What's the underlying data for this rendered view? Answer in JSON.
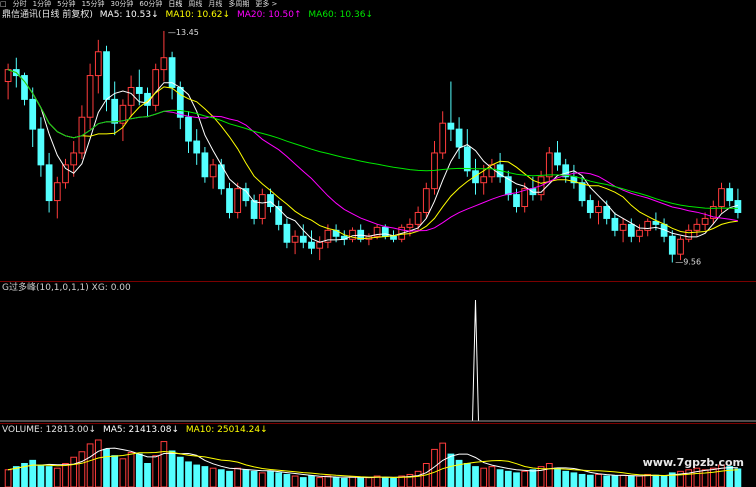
{
  "toolbar": {
    "items": [
      "□",
      "分时",
      "1分钟",
      "5分钟",
      "15分钟",
      "30分钟",
      "60分钟",
      "日线",
      "周线",
      "月线",
      "多周期",
      "更多 >"
    ],
    "active_index": 7
  },
  "main_legend": {
    "title": "鼎信通讯(日线 前复权)",
    "ma5_label": "MA5: 10.53↓",
    "ma10_label": "MA10: 10.62↓",
    "ma20_label": "MA20: 10.50↑",
    "ma60_label": "MA60: 10.36↓"
  },
  "indicator_legend": {
    "text": "G过多峰(10,1,0,1,1)  XG: 0.00"
  },
  "volume_legend": {
    "volume_label": "VOLUME: 12813.00↓",
    "ma5_label": "MA5: 21413.08↓",
    "ma10_label": "MA10: 25014.24↓"
  },
  "watermark": "www.7gpzb.com",
  "colors": {
    "up": "#ff3c3c",
    "down": "#54ffff",
    "ma5": "#ffffff",
    "ma10": "#ffff00",
    "ma20": "#ff00ff",
    "ma60": "#00e600",
    "signal": "#ffffff",
    "grid": "#7a0000"
  },
  "chart_data": {
    "type": "candlestick",
    "price_high_label": "13.45",
    "price_low_label": "9.56",
    "ohlc": [
      [
        12.6,
        12.9,
        12.3,
        12.8
      ],
      [
        12.8,
        13.0,
        12.5,
        12.7
      ],
      [
        12.7,
        12.75,
        12.2,
        12.3
      ],
      [
        12.3,
        12.5,
        11.5,
        11.8
      ],
      [
        11.8,
        12.0,
        11.0,
        11.2
      ],
      [
        11.2,
        11.4,
        10.4,
        10.6
      ],
      [
        10.6,
        11.0,
        10.3,
        10.9
      ],
      [
        10.9,
        11.3,
        10.8,
        11.2
      ],
      [
        11.2,
        11.6,
        11.0,
        11.4
      ],
      [
        11.4,
        12.2,
        11.3,
        12.0
      ],
      [
        12.0,
        12.9,
        11.8,
        12.7
      ],
      [
        12.7,
        13.3,
        12.4,
        13.1
      ],
      [
        13.1,
        13.2,
        12.1,
        12.3
      ],
      [
        12.3,
        12.6,
        11.7,
        11.9
      ],
      [
        11.9,
        12.3,
        11.6,
        12.2
      ],
      [
        12.2,
        12.7,
        12.0,
        12.5
      ],
      [
        12.5,
        12.8,
        12.2,
        12.4
      ],
      [
        12.4,
        12.5,
        12.0,
        12.2
      ],
      [
        12.2,
        12.9,
        12.1,
        12.8
      ],
      [
        12.8,
        13.45,
        12.6,
        13.0
      ],
      [
        13.0,
        13.1,
        12.3,
        12.5
      ],
      [
        12.5,
        12.6,
        11.8,
        12.0
      ],
      [
        12.0,
        12.1,
        11.4,
        11.6
      ],
      [
        11.6,
        11.8,
        11.2,
        11.4
      ],
      [
        11.4,
        11.5,
        10.9,
        11.0
      ],
      [
        11.0,
        11.3,
        10.8,
        11.2
      ],
      [
        11.2,
        11.3,
        10.7,
        10.8
      ],
      [
        10.8,
        10.9,
        10.3,
        10.4
      ],
      [
        10.4,
        10.9,
        10.3,
        10.8
      ],
      [
        10.8,
        10.9,
        10.5,
        10.6
      ],
      [
        10.6,
        10.7,
        10.2,
        10.3
      ],
      [
        10.3,
        10.8,
        10.2,
        10.7
      ],
      [
        10.7,
        10.8,
        10.4,
        10.5
      ],
      [
        10.5,
        10.6,
        10.1,
        10.2
      ],
      [
        10.2,
        10.3,
        9.8,
        9.9
      ],
      [
        9.9,
        10.1,
        9.7,
        10.0
      ],
      [
        10.0,
        10.2,
        9.8,
        9.9
      ],
      [
        9.9,
        10.1,
        9.7,
        9.8
      ],
      [
        9.8,
        10.0,
        9.6,
        9.9
      ],
      [
        9.9,
        10.2,
        9.8,
        10.1
      ],
      [
        10.1,
        10.2,
        9.9,
        10.0
      ],
      [
        10.0,
        10.1,
        9.85,
        9.95
      ],
      [
        9.95,
        10.15,
        9.9,
        10.1
      ],
      [
        10.1,
        10.2,
        9.9,
        9.95
      ],
      [
        9.95,
        10.05,
        9.85,
        10.0
      ],
      [
        10.0,
        10.2,
        9.95,
        10.15
      ],
      [
        10.15,
        10.2,
        9.95,
        10.0
      ],
      [
        10.0,
        10.1,
        9.9,
        9.95
      ],
      [
        9.95,
        10.2,
        9.9,
        10.15
      ],
      [
        10.15,
        10.3,
        10.0,
        10.2
      ],
      [
        10.2,
        10.5,
        10.1,
        10.4
      ],
      [
        10.4,
        10.9,
        10.3,
        10.8
      ],
      [
        10.8,
        11.6,
        10.7,
        11.4
      ],
      [
        11.4,
        12.1,
        11.3,
        11.9
      ],
      [
        11.9,
        12.6,
        11.6,
        11.8
      ],
      [
        11.8,
        12.0,
        11.3,
        11.5
      ],
      [
        11.5,
        11.8,
        11.0,
        11.1
      ],
      [
        11.1,
        11.3,
        10.7,
        10.9
      ],
      [
        10.9,
        11.2,
        10.7,
        11.0
      ],
      [
        11.0,
        11.3,
        10.9,
        11.2
      ],
      [
        11.2,
        11.4,
        10.9,
        11.0
      ],
      [
        11.0,
        11.1,
        10.6,
        10.7
      ],
      [
        10.7,
        10.8,
        10.4,
        10.5
      ],
      [
        10.5,
        10.9,
        10.4,
        10.8
      ],
      [
        10.8,
        11.0,
        10.6,
        10.7
      ],
      [
        10.7,
        11.1,
        10.6,
        11.0
      ],
      [
        11.0,
        11.5,
        10.9,
        11.4
      ],
      [
        11.4,
        11.6,
        11.1,
        11.2
      ],
      [
        11.2,
        11.3,
        10.9,
        11.0
      ],
      [
        11.0,
        11.2,
        10.8,
        10.9
      ],
      [
        10.9,
        11.0,
        10.5,
        10.6
      ],
      [
        10.6,
        10.7,
        10.3,
        10.4
      ],
      [
        10.4,
        10.6,
        10.2,
        10.5
      ],
      [
        10.5,
        10.6,
        10.2,
        10.3
      ],
      [
        10.3,
        10.4,
        10.0,
        10.1
      ],
      [
        10.1,
        10.3,
        9.9,
        10.2
      ],
      [
        10.2,
        10.3,
        9.9,
        10.0
      ],
      [
        10.0,
        10.2,
        9.9,
        10.1
      ],
      [
        10.1,
        10.3,
        10.0,
        10.25
      ],
      [
        10.25,
        10.4,
        10.1,
        10.2
      ],
      [
        10.2,
        10.3,
        9.9,
        10.0
      ],
      [
        10.0,
        10.1,
        9.56,
        9.7
      ],
      [
        9.7,
        10.0,
        9.6,
        9.95
      ],
      [
        9.95,
        10.2,
        9.9,
        10.1
      ],
      [
        10.1,
        10.3,
        10.0,
        10.2
      ],
      [
        10.2,
        10.4,
        10.1,
        10.3
      ],
      [
        10.3,
        10.6,
        10.2,
        10.5
      ],
      [
        10.5,
        10.9,
        10.4,
        10.8
      ],
      [
        10.8,
        10.9,
        10.5,
        10.6
      ],
      [
        10.6,
        10.8,
        10.3,
        10.4
      ]
    ],
    "volume": [
      22,
      26,
      30,
      34,
      28,
      26,
      24,
      30,
      38,
      45,
      55,
      60,
      48,
      40,
      36,
      44,
      42,
      30,
      40,
      58,
      46,
      38,
      32,
      28,
      26,
      24,
      22,
      20,
      24,
      22,
      20,
      18,
      20,
      18,
      16,
      14,
      12,
      14,
      12,
      14,
      12,
      11,
      13,
      12,
      12,
      14,
      12,
      11,
      14,
      16,
      20,
      30,
      48,
      56,
      42,
      34,
      30,
      26,
      24,
      26,
      22,
      20,
      18,
      20,
      22,
      26,
      30,
      24,
      20,
      18,
      16,
      15,
      16,
      14,
      14,
      15,
      14,
      14,
      16,
      15,
      14,
      18,
      20,
      22,
      24,
      22,
      24,
      28,
      26,
      23
    ],
    "signals": [
      57,
      106
    ]
  }
}
